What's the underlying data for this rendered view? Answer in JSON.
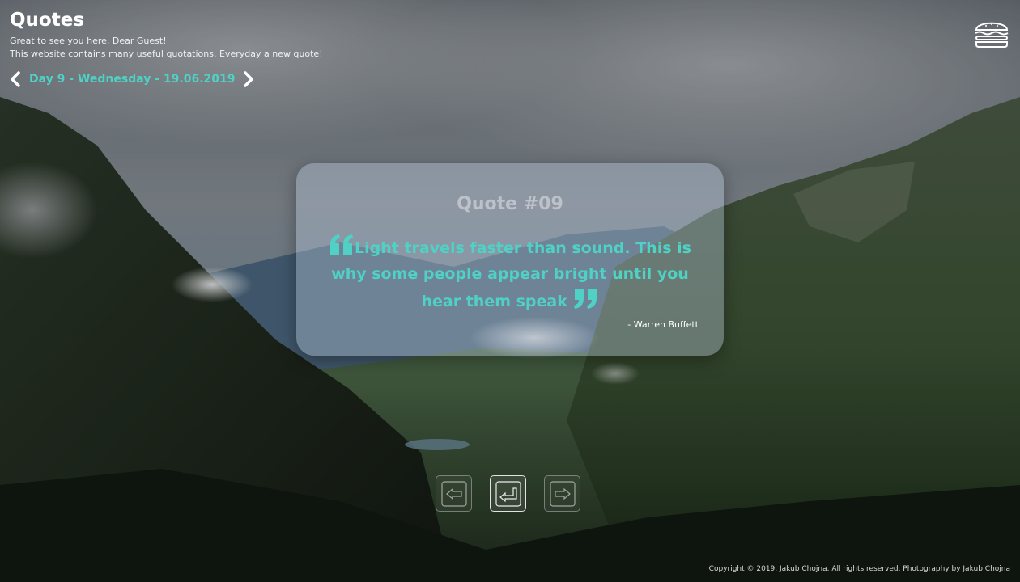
{
  "header": {
    "title": "Quotes",
    "greeting": "Great to see you here, Dear Guest!",
    "subtitle": "This website contains many useful quotations. Everyday a new quote!"
  },
  "day_nav": {
    "label": "Day 9 - Wednesday - 19.06.2019",
    "prev_icon": "chevron-left-icon",
    "next_icon": "chevron-right-icon"
  },
  "menu": {
    "icon": "hamburger-icon"
  },
  "quote": {
    "number": "Quote #09",
    "text": "Light travels faster than sound. This is why some people appear bright until you hear them speak",
    "author": "- Warren Buffett",
    "open_icon": "quote-open-icon",
    "close_icon": "quote-close-icon"
  },
  "controls": [
    {
      "icon": "arrow-left-key-icon",
      "active": false
    },
    {
      "icon": "enter-key-icon",
      "active": true
    },
    {
      "icon": "arrow-right-key-icon",
      "active": false
    }
  ],
  "footer": {
    "copyright": "Copyright © 2019, Jakub Chojna. All rights reserved. Photography by Jakub Chojna"
  },
  "colors": {
    "accent": "#4fd1c5",
    "text": "#ffffff"
  }
}
